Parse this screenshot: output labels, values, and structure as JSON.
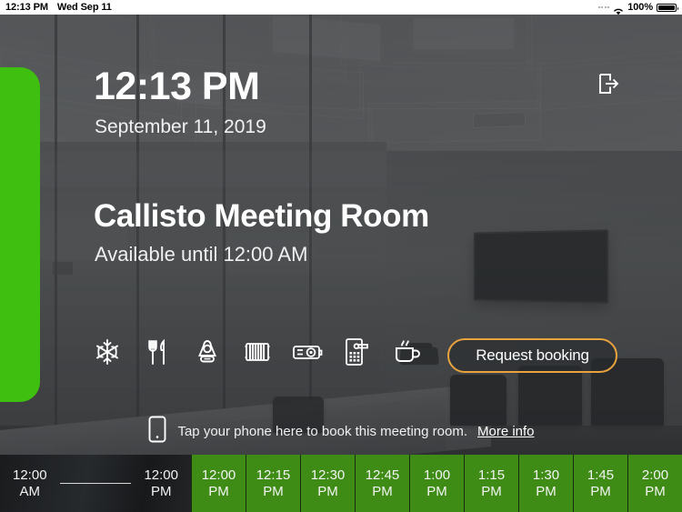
{
  "status_bar": {
    "time": "12:13 PM",
    "date": "Wed Sep 11",
    "battery_percent": "100%",
    "wifi_icon": "wifi-icon",
    "battery_icon": "battery-full-icon",
    "signal_icon": "signal-dots-icon"
  },
  "header": {
    "clock": "12:13 PM",
    "date": "September 11, 2019",
    "logout_icon": "logout-icon"
  },
  "room": {
    "name": "Callisto Meeting Room",
    "availability": "Available until 12:00 AM",
    "status_color": "#3fbf10"
  },
  "amenities": [
    {
      "name": "air-conditioning-icon",
      "label": "Air conditioning"
    },
    {
      "name": "catering-icon",
      "label": "Catering"
    },
    {
      "name": "conference-phone-icon",
      "label": "Conference phone"
    },
    {
      "name": "heating-icon",
      "label": "Heating"
    },
    {
      "name": "projector-icon",
      "label": "Projector"
    },
    {
      "name": "access-keypad-icon",
      "label": "Access keypad"
    },
    {
      "name": "refreshments-icon",
      "label": "Refreshments"
    }
  ],
  "request_button": {
    "label": "Request booking",
    "border_color": "#e8a33d"
  },
  "tap_bar": {
    "phone_icon": "phone-icon",
    "text": "Tap your phone here to book this meeting room.",
    "more_info": "More info"
  },
  "timeline": {
    "past_start": "12:00\nAM",
    "past_end": "12:00\nPM",
    "free_color": "#3e8c16",
    "slots": [
      "12:00\nPM",
      "12:15\nPM",
      "12:30\nPM",
      "12:45\nPM",
      "1:00\nPM",
      "1:15\nPM",
      "1:30\nPM",
      "1:45\nPM",
      "2:00\nPM"
    ]
  }
}
